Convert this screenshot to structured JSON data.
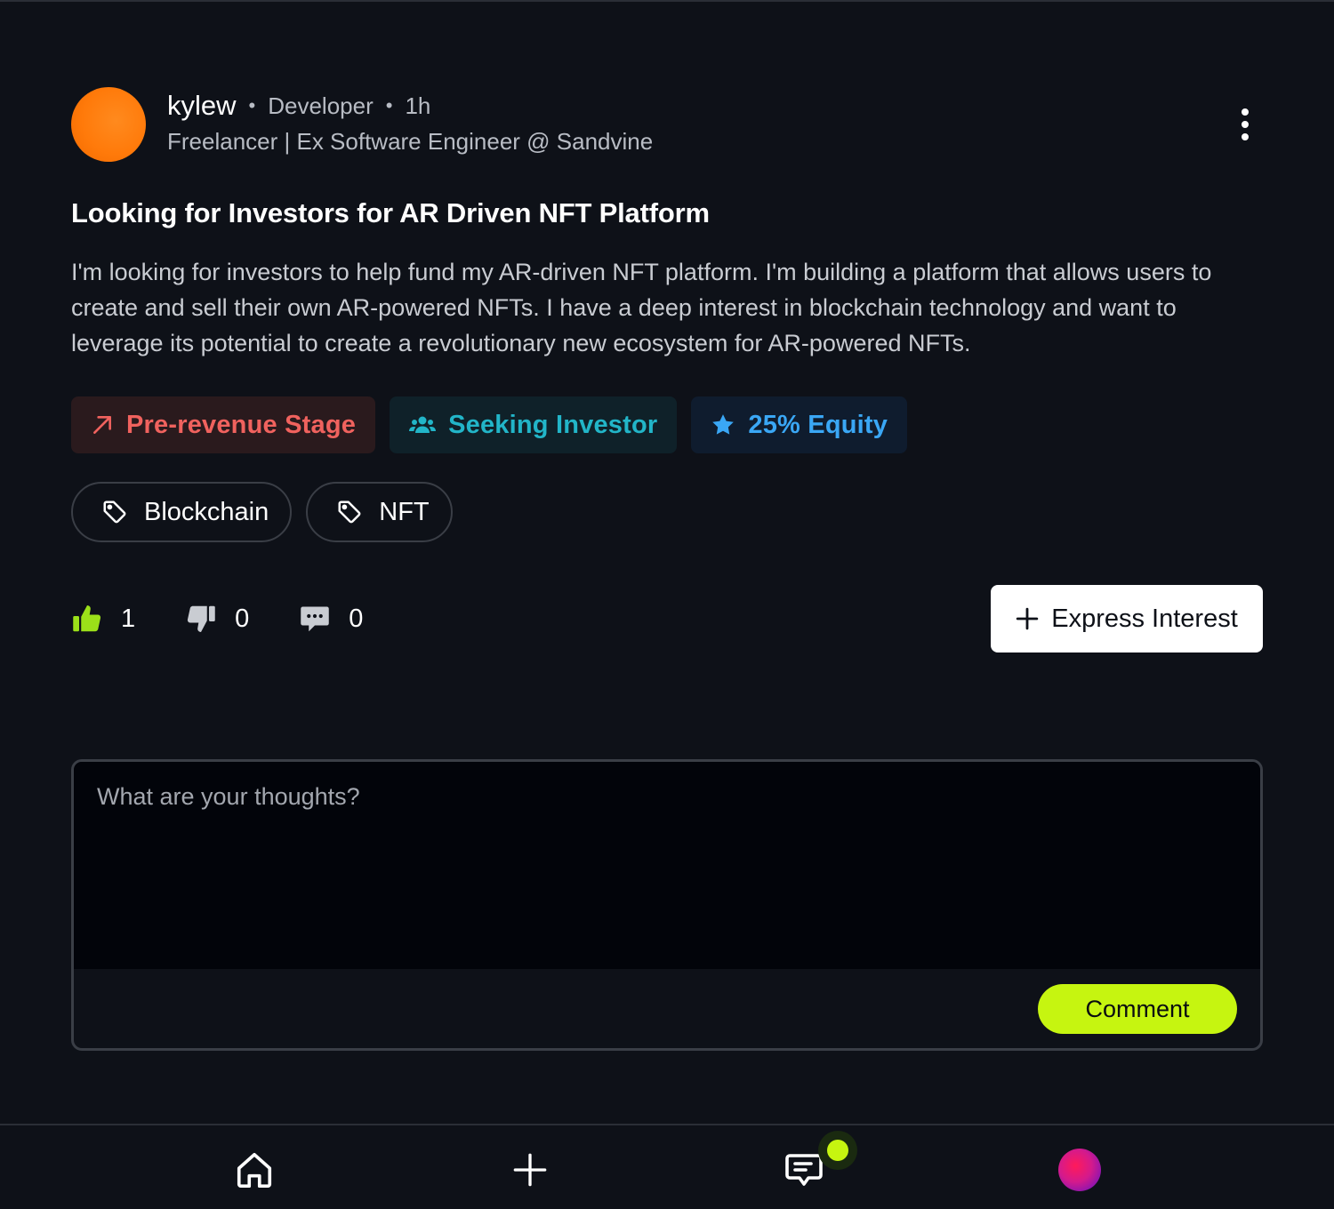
{
  "post": {
    "author": {
      "username": "kylew",
      "role": "Developer",
      "time": "1h",
      "subtitle": "Freelancer | Ex Software Engineer @ Sandvine",
      "separator": "•"
    },
    "title": "Looking for Investors for AR Driven NFT Platform",
    "body": "I'm looking for investors to help fund my AR-driven NFT platform. I'm building a platform that allows users to create and sell their own AR-powered NFTs. I have a deep interest in blockchain technology and want to leverage its potential to create a revolutionary new ecosystem for AR-powered NFTs.",
    "badges": {
      "stage": "Pre-revenue Stage",
      "seeking": "Seeking Investor",
      "equity": "25% Equity"
    },
    "tags": [
      "Blockchain",
      "NFT"
    ],
    "reactions": {
      "likes": "1",
      "dislikes": "0",
      "comments": "0"
    },
    "express_interest_label": "Express Interest"
  },
  "comment": {
    "placeholder": "What are your thoughts?",
    "submit_label": "Comment"
  },
  "nav": {
    "items": [
      "home-icon",
      "plus-icon",
      "chat-icon",
      "profile-avatar"
    ],
    "has_notification": true
  },
  "colors": {
    "background": "#0e1118",
    "accent": "#c6f510",
    "stage": "#f0625e",
    "seeking": "#22b5c8",
    "equity": "#3aa7f5"
  }
}
